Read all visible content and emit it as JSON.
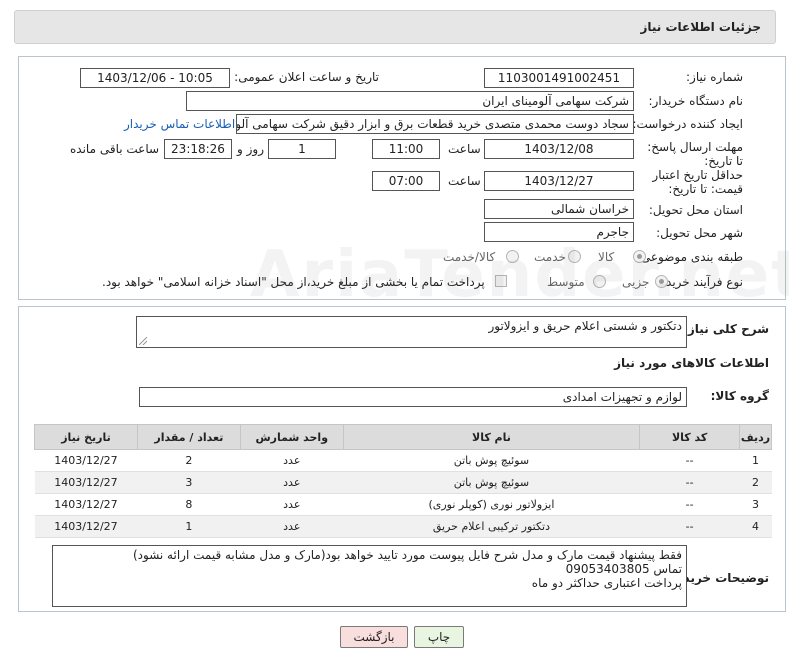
{
  "title": "جزئیات اطلاعات نیاز",
  "form": {
    "need_number_label": "شماره نیاز:",
    "need_number": "1103001491002451",
    "announce_label": "تاریخ و ساعت اعلان عمومی:",
    "announce_value": "1403/12/06 - 10:05",
    "buyer_org_label": "نام دستگاه خریدار:",
    "buyer_org": "شرکت سهامی آلومینای ایران",
    "creator_label": "ایجاد کننده درخواست:",
    "creator": "سجاد دوست محمدی متصدی خرید قطعات برق و ابزار دقیق شرکت سهامی آلومینای ایران",
    "contact_link": "اطلاعات تماس خریدار",
    "deadline_label": "مهلت ارسال پاسخ: تا تاریخ:",
    "deadline_date": "1403/12/08",
    "time_word": "ساعت",
    "deadline_time": "11:00",
    "days": "1",
    "days_label": "روز و",
    "remaining": "23:18:26",
    "remaining_label": "ساعت باقی مانده",
    "validity_label": "حداقل تاریخ اعتبار قیمت: تا تاریخ:",
    "validity_date": "1403/12/27",
    "validity_time": "07:00",
    "province_label": "استان محل تحویل:",
    "province": "خراسان شمالی",
    "city_label": "شهر محل تحویل:",
    "city": "جاجرم",
    "category_label": "طبقه بندی موضوعی:",
    "category_options": [
      "کالا",
      "خدمت",
      "کالا/خدمت"
    ],
    "process_label": "نوع فرآیند خرید :",
    "process_options": [
      "جزیی",
      "متوسط"
    ],
    "payment_note": "پرداخت تمام یا بخشی از مبلغ خرید،از محل \"اسناد خزانه اسلامی\" خواهد بود."
  },
  "details": {
    "desc_label": "شرح کلی نیاز:",
    "desc": "دتکتور و شستی اعلام حریق و ایزولاتور",
    "goods_info_title": "اطلاعات کالاهای مورد نیاز",
    "group_label": "گروه کالا:",
    "group": "لوازم و تجهیزات امدادی",
    "columns": [
      "ردیف",
      "کد کالا",
      "نام کالا",
      "واحد شمارش",
      "تعداد / مقدار",
      "تاریخ نیاز"
    ],
    "rows": [
      {
        "n": "1",
        "code": "--",
        "name": "سوئیچ پوش باتن",
        "unit": "عدد",
        "qty": "2",
        "date": "1403/12/27"
      },
      {
        "n": "2",
        "code": "--",
        "name": "سوئیچ پوش باتن",
        "unit": "عدد",
        "qty": "3",
        "date": "1403/12/27"
      },
      {
        "n": "3",
        "code": "--",
        "name": "ایزولاتور نوری (کوپلر نوری)",
        "unit": "عدد",
        "qty": "8",
        "date": "1403/12/27"
      },
      {
        "n": "4",
        "code": "--",
        "name": "دتکتور ترکیبی اعلام حریق",
        "unit": "عدد",
        "qty": "1",
        "date": "1403/12/27"
      }
    ],
    "buyer_notes_label": "توضیحات خریدار:",
    "buyer_notes": [
      "فقط پیشنهاد قیمت مارک و مدل شرح فایل پیوست مورد تایید خواهد بود(مارک و مدل مشابه قیمت ارائه نشود)",
      "تماس 09053403805",
      "پرداخت اعتباری حداکثر دو ماه"
    ]
  },
  "buttons": {
    "print": "چاپ",
    "back": "بازگشت"
  },
  "watermark": "AriaTender.net",
  "colors": {
    "link": "#1a5fb4",
    "print_button": "#e8f5e0",
    "back_button": "#f9dede"
  }
}
